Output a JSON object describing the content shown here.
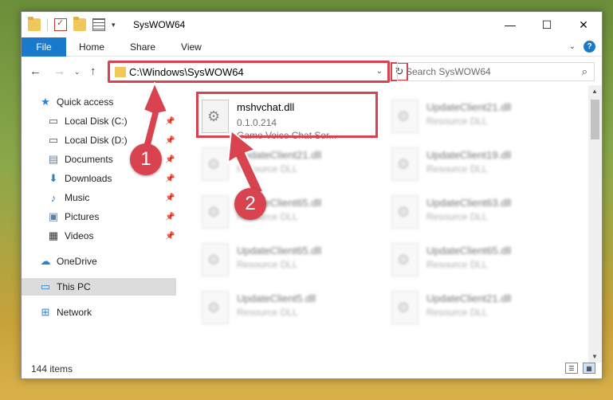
{
  "window": {
    "title": "SysWOW64",
    "minimize": "—",
    "maximize": "☐",
    "close": "✕"
  },
  "ribbon": {
    "tabs": [
      "File",
      "Home",
      "Share",
      "View"
    ]
  },
  "navbar": {
    "address": "C:\\Windows\\SysWOW64",
    "search_placeholder": "Search SysWOW64"
  },
  "sidebar": {
    "items": [
      {
        "label": "Quick access",
        "icon": "star-icon",
        "pinned": false
      },
      {
        "label": "Local Disk (C:)",
        "icon": "drive-icon",
        "pinned": true
      },
      {
        "label": "Local Disk (D:)",
        "icon": "drive-icon",
        "pinned": true
      },
      {
        "label": "Documents",
        "icon": "documents-icon",
        "pinned": true
      },
      {
        "label": "Downloads",
        "icon": "downloads-icon",
        "pinned": true
      },
      {
        "label": "Music",
        "icon": "music-icon",
        "pinned": true
      },
      {
        "label": "Pictures",
        "icon": "pictures-icon",
        "pinned": true
      },
      {
        "label": "Videos",
        "icon": "videos-icon",
        "pinned": true
      },
      {
        "label": "OneDrive",
        "icon": "onedrive-icon",
        "pinned": false
      },
      {
        "label": "This PC",
        "icon": "this-pc-icon",
        "pinned": false
      },
      {
        "label": "Network",
        "icon": "network-icon",
        "pinned": false
      }
    ]
  },
  "files": {
    "highlighted": {
      "name": "mshvchat.dll",
      "version": "0.1.0.214",
      "description": "Game Voice Chat Ser..."
    },
    "left_column": [
      {
        "name": "UpdateClient21.dll",
        "type": "Resource DLL"
      },
      {
        "name": "UpdateClient65.dll",
        "type": "Resource DLL"
      },
      {
        "name": "UpdateClient65.dll",
        "type": "Resource DLL"
      },
      {
        "name": "UpdateClient5.dll",
        "type": "Resource DLL"
      }
    ],
    "right_column": [
      {
        "name": "UpdateClient21.dll",
        "type": "Resource DLL"
      },
      {
        "name": "UpdateClient19.dll",
        "type": "Resource DLL"
      },
      {
        "name": "UpdateClient63.dll",
        "type": "Resource DLL"
      },
      {
        "name": "UpdateClient65.dll",
        "type": "Resource DLL"
      },
      {
        "name": "UpdateClient21.dll",
        "type": "Resource DLL"
      }
    ]
  },
  "status": {
    "count": "144 items"
  },
  "callouts": [
    "1",
    "2"
  ],
  "colors": {
    "accent": "#1979ca",
    "annotation": "#d9434f"
  }
}
